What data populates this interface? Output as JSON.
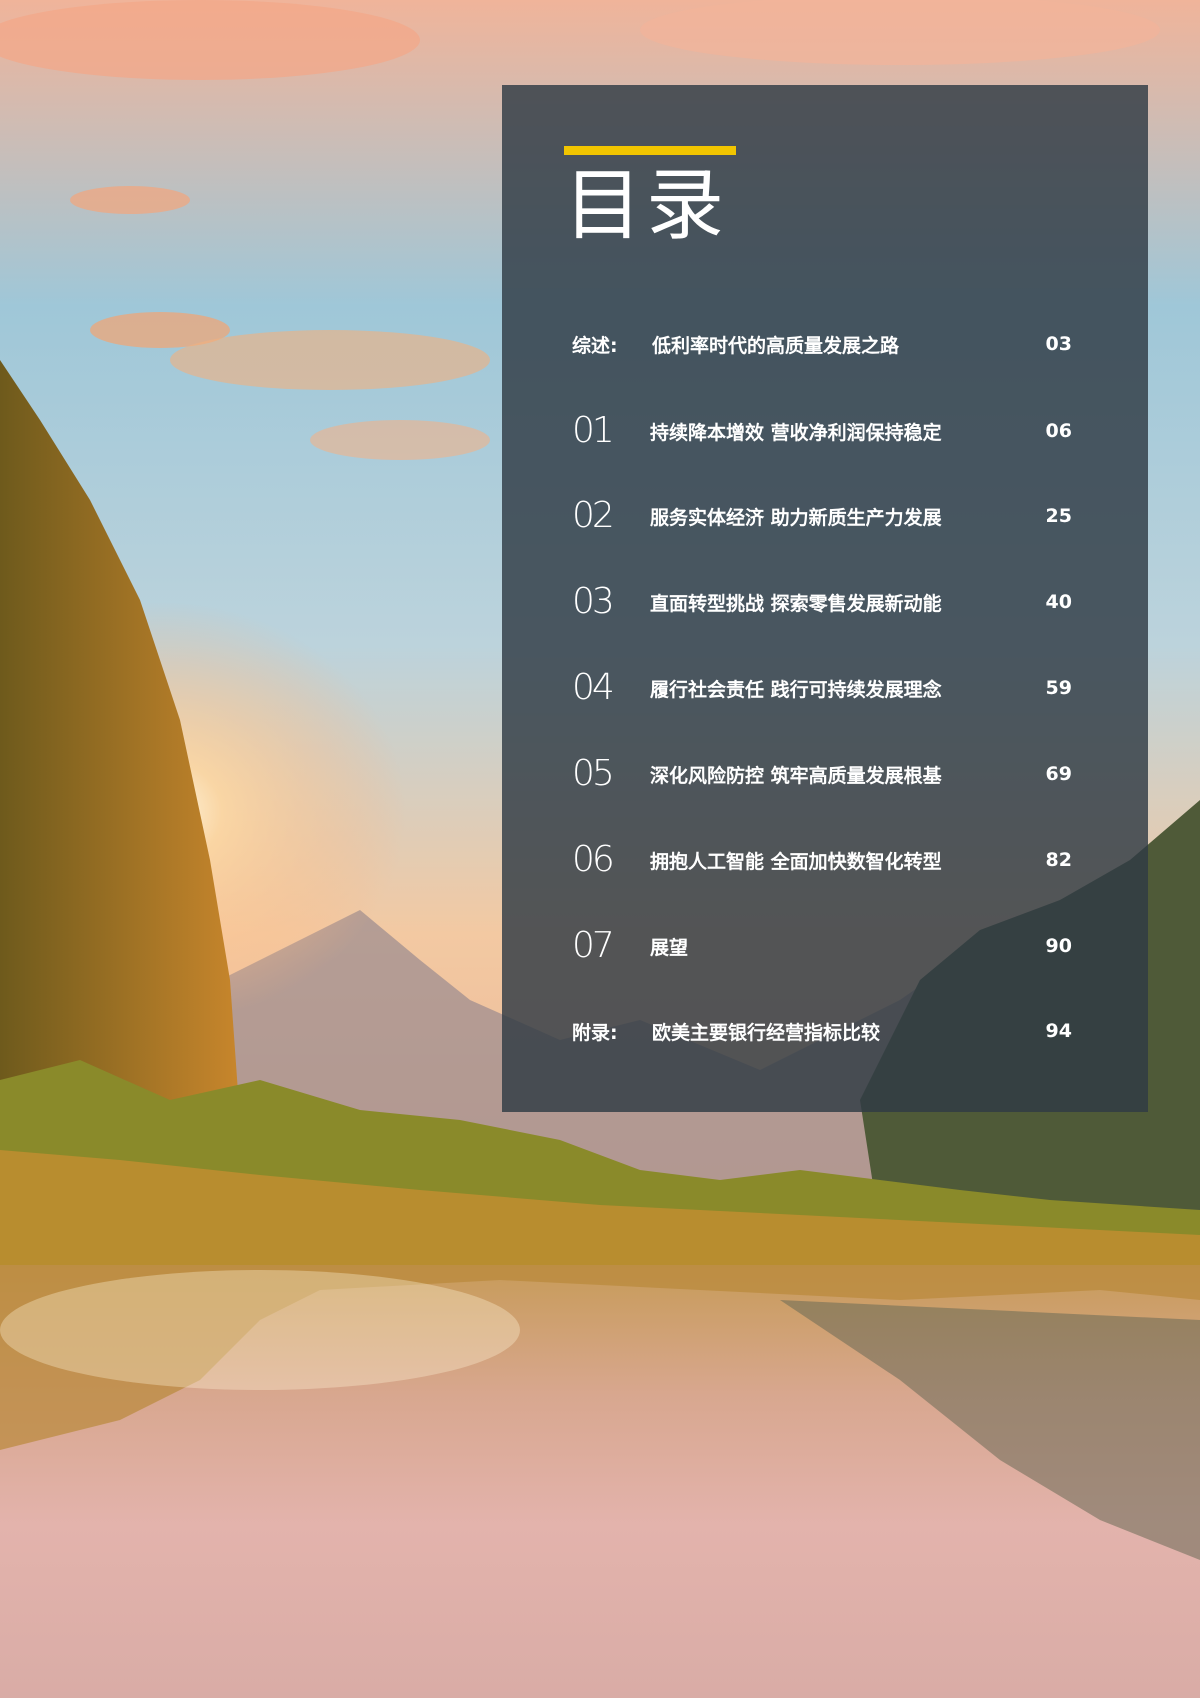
{
  "toc": {
    "title": "目录",
    "accent_color": "#f2c500",
    "items": [
      {
        "prefix": "综述:",
        "title": "低利率时代的高质量发展之路",
        "page": "03"
      },
      {
        "num": "01",
        "title": "持续降本增效 营收净利润保持稳定",
        "page": "06"
      },
      {
        "num": "02",
        "title": "服务实体经济 助力新质生产力发展",
        "page": "25"
      },
      {
        "num": "03",
        "title": "直面转型挑战 探索零售发展新动能",
        "page": "40"
      },
      {
        "num": "04",
        "title": "履行社会责任 践行可持续发展理念",
        "page": "59"
      },
      {
        "num": "05",
        "title": "深化风险防控 筑牢高质量发展根基",
        "page": "69"
      },
      {
        "num": "06",
        "title": "拥抱人工智能 全面加快数智化转型",
        "page": "82"
      },
      {
        "num": "07",
        "title": "展望",
        "page": "90"
      },
      {
        "prefix": "附录:",
        "title": "欧美主要银行经营指标比较",
        "page": "94"
      }
    ]
  }
}
